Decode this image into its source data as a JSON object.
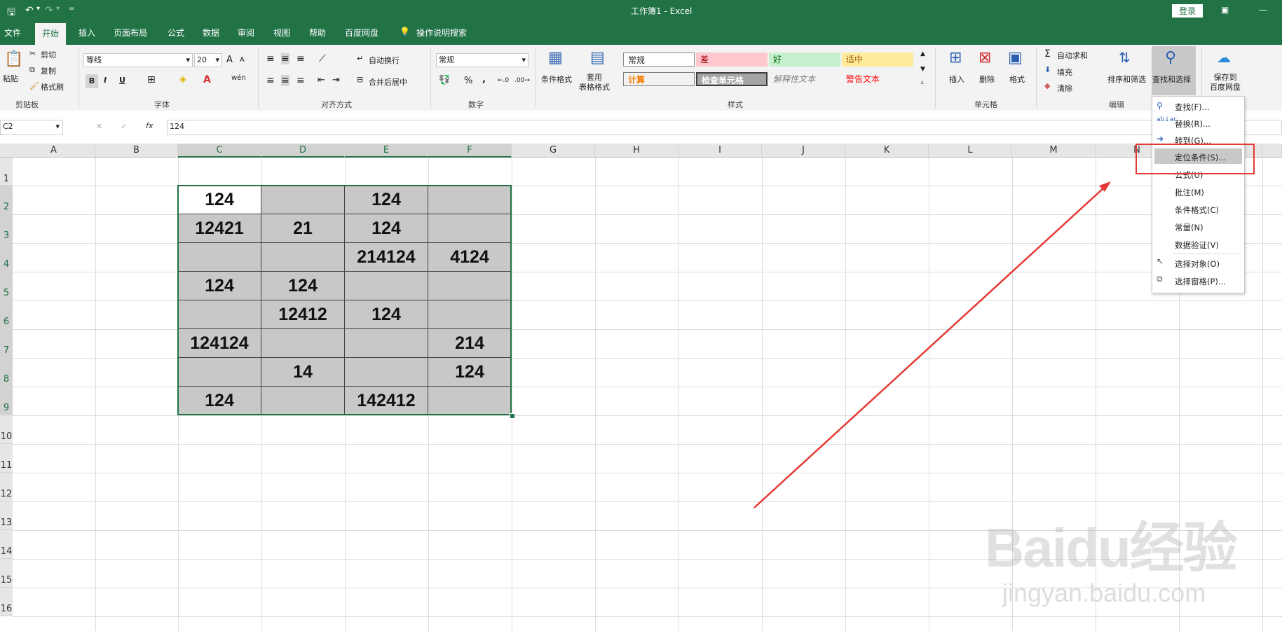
{
  "titlebar": {
    "title": "工作簿1  -  Excel",
    "login": "登录",
    "qat_more": "="
  },
  "tabs": [
    "文件",
    "开始",
    "插入",
    "页面布局",
    "公式",
    "数据",
    "审阅",
    "视图",
    "帮助",
    "百度网盘",
    "操作说明搜索"
  ],
  "ribbon": {
    "clipboard": {
      "paste": "粘贴",
      "cut": "剪切",
      "copy": "复制",
      "painter": "格式刷",
      "label": "剪贴板"
    },
    "font": {
      "name": "等线",
      "size": "20",
      "label": "字体",
      "bold": "B",
      "italic": "I",
      "underline": "U",
      "grow": "A",
      "shrink": "A",
      "phonetic": "wén"
    },
    "align": {
      "wrap": "自动换行",
      "merge": "合并后居中",
      "label": "对齐方式"
    },
    "number": {
      "format": "常规",
      "label": "数字",
      "percent": "%",
      "comma": ","
    },
    "styles": {
      "cond": "条件格式",
      "table": "套用\n表格格式",
      "label": "样式",
      "cells": [
        "常规",
        "差",
        "好",
        "适中",
        "计算",
        "检查单元格",
        "解释性文本",
        "警告文本"
      ]
    },
    "cells": {
      "insert": "插入",
      "delete": "删除",
      "format": "格式",
      "label": "单元格"
    },
    "editing": {
      "autosum": "自动求和",
      "fill": "填充",
      "clear": "清除",
      "sort": "排序和筛选",
      "find": "查找和选择",
      "label": "编辑"
    },
    "save": {
      "label": "保存到\n百度网盘"
    }
  },
  "formula_bar": {
    "name_box": "C2",
    "cancel": "✕",
    "enter": "✓",
    "fx": "fx",
    "value": "124"
  },
  "columns": [
    "A",
    "B",
    "C",
    "D",
    "E",
    "F",
    "G",
    "H",
    "I",
    "J",
    "K",
    "L",
    "M",
    "N",
    "O"
  ],
  "rows": [
    "1",
    "2",
    "3",
    "4",
    "5",
    "6",
    "7",
    "8",
    "9",
    "10",
    "11",
    "12",
    "13",
    "14",
    "15",
    "16"
  ],
  "grid": [
    [
      "124",
      "",
      "124",
      ""
    ],
    [
      "12421",
      "21",
      "124",
      ""
    ],
    [
      "",
      "",
      "214124",
      "4124"
    ],
    [
      "124",
      "124",
      "",
      ""
    ],
    [
      "",
      "12412",
      "124",
      ""
    ],
    [
      "124124",
      "",
      "",
      "214"
    ],
    [
      "",
      "14",
      "",
      "124"
    ],
    [
      "124",
      "",
      "142412",
      ""
    ]
  ],
  "menu": {
    "items": [
      "查找(F)...",
      "替换(R)...",
      "转到(G)...",
      "定位条件(S)...",
      "公式(U)",
      "批注(M)",
      "条件格式(C)",
      "常量(N)",
      "数据验证(V)",
      "选择对象(O)",
      "选择窗格(P)..."
    ],
    "highlighted": "定位条件(S)..."
  },
  "watermark": {
    "brand": "Baidu经验",
    "url": "jingyan.baidu.com"
  },
  "colors": {
    "excel_green": "#217346",
    "annotation_red": "#e53935",
    "selection_gray": "#c8c8c8"
  }
}
